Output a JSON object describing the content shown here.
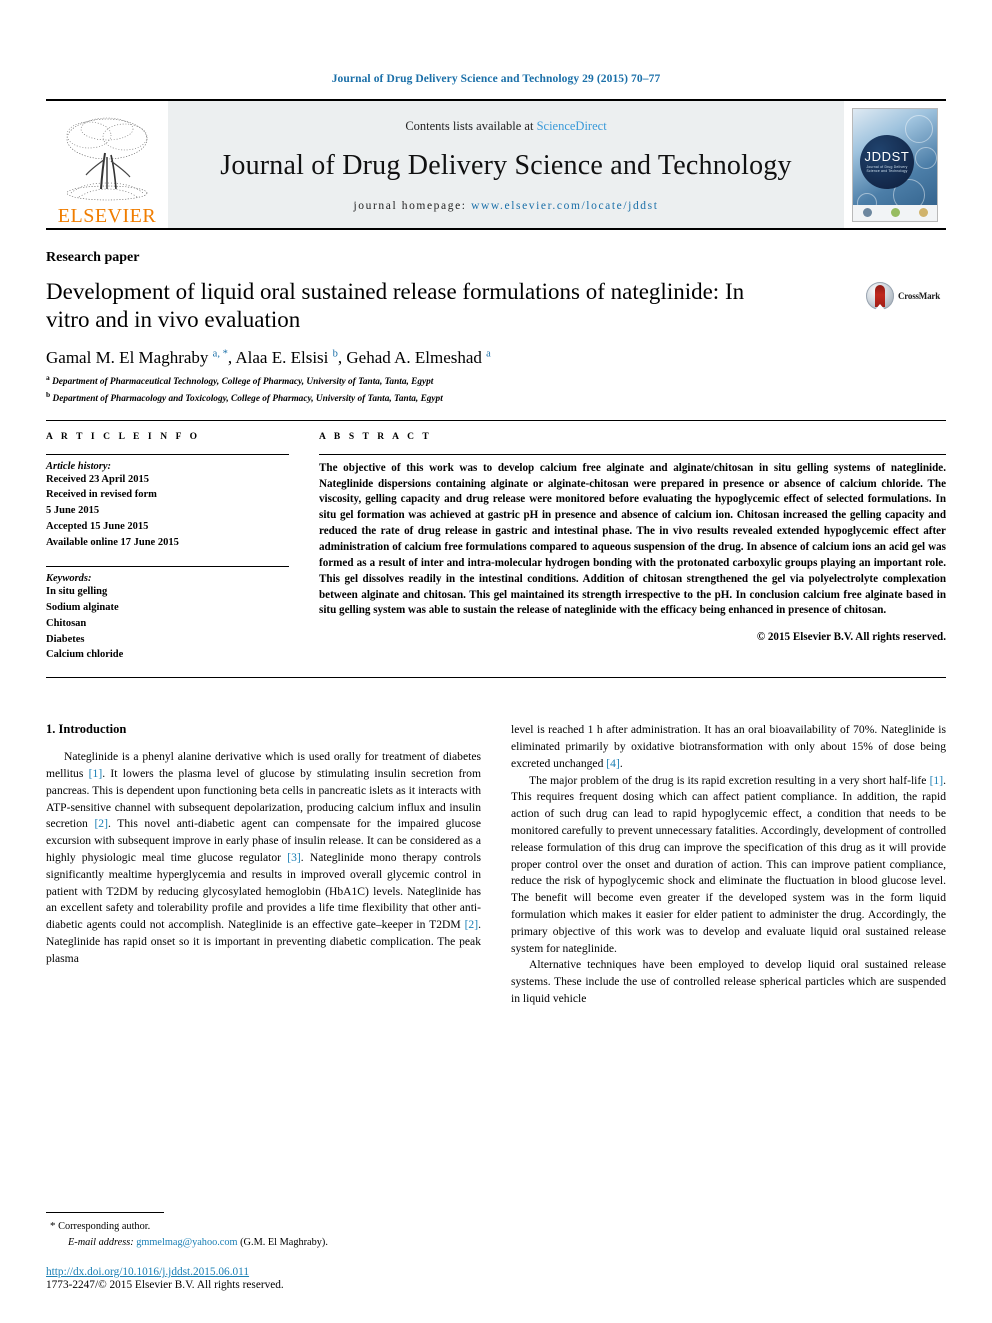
{
  "running_head": "Journal of Drug Delivery Science and Technology 29 (2015) 70–77",
  "masthead": {
    "publisher": "ELSEVIER",
    "contents_prefix": "Contents lists available at ",
    "sciencedirect": "ScienceDirect",
    "journal_title": "Journal of Drug Delivery Science and Technology",
    "homepage_prefix": "journal homepage: ",
    "homepage_url": "www.elsevier.com/locate/jddst",
    "cover_title": "JDDST",
    "cover_subtitle": "Journal of Drug Delivery Science and Technology"
  },
  "article": {
    "type": "Research paper",
    "title": "Development of liquid oral sustained release formulations of nateglinide: In vitro and in vivo evaluation",
    "crossmark_label": "CrossMark",
    "authors_html": "Gamal M. El Maghraby <sup>a, *</sup>, Alaa E. Elsisi <sup>b</sup>, Gehad A. Elmeshad <sup>a</sup>",
    "affiliations": [
      {
        "marker": "a",
        "text": "Department of Pharmaceutical Technology, College of Pharmacy, University of Tanta, Tanta, Egypt"
      },
      {
        "marker": "b",
        "text": "Department of Pharmacology and Toxicology, College of Pharmacy, University of Tanta, Tanta, Egypt"
      }
    ]
  },
  "article_info": {
    "heading": "A R T I C L E  I N F O",
    "history_label": "Article history:",
    "history_lines": [
      "Received 23 April 2015",
      "Received in revised form",
      "5 June 2015",
      "Accepted 15 June 2015",
      "Available online 17 June 2015"
    ],
    "keywords_label": "Keywords:",
    "keywords": [
      "In situ gelling",
      "Sodium alginate",
      "Chitosan",
      "Diabetes",
      "Calcium chloride"
    ]
  },
  "abstract": {
    "heading": "A B S T R A C T",
    "text": "The objective of this work was to develop calcium free alginate and alginate/chitosan in situ gelling systems of nateglinide. Nateglinide dispersions containing alginate or alginate-chitosan were prepared in presence or absence of calcium chloride. The viscosity, gelling capacity and drug release were monitored before evaluating the hypoglycemic effect of selected formulations. In situ gel formation was achieved at gastric pH in presence and absence of calcium ion. Chitosan increased the gelling capacity and reduced the rate of drug release in gastric and intestinal phase. The in vivo results revealed extended hypoglycemic effect after administration of calcium free formulations compared to aqueous suspension of the drug. In absence of calcium ions an acid gel was formed as a result of inter and intra-molecular hydrogen bonding with the protonated carboxylic groups playing an important role. This gel dissolves readily in the intestinal conditions. Addition of chitosan strengthened the gel via polyelectrolyte complexation between alginate and chitosan. This gel maintained its strength irrespective to the pH. In conclusion calcium free alginate based in situ gelling system was able to sustain the release of nateglinide with the efficacy being enhanced in presence of chitosan.",
    "copyright": "© 2015 Elsevier B.V. All rights reserved."
  },
  "body": {
    "section_heading": "1. Introduction",
    "left_paragraph_1_html": "Nateglinide is a phenyl alanine derivative which is used orally for treatment of diabetes mellitus <span class=\"ref\">[1]</span>. It lowers the plasma level of glucose by stimulating insulin secretion from pancreas. This is dependent upon functioning beta cells in pancreatic islets as it interacts with ATP-sensitive channel with subsequent depolarization, producing calcium influx and insulin secretion <span class=\"ref\">[2]</span>. This novel anti-diabetic agent can compensate for the impaired glucose excursion with subsequent improve in early phase of insulin release. It can be considered as a highly physiologic meal time glucose regulator <span class=\"ref\">[3]</span>. Nateglinide mono therapy controls significantly mealtime hyperglycemia and results in improved overall glycemic control in patient with T2DM by reducing glycosylated hemoglobin (HbA1C) levels. Nateglinide has an excellent safety and tolerability profile and provides a life time flexibility that other anti-diabetic agents could not accomplish. Nateglinide is an effective gate–keeper in T2DM <span class=\"ref\">[2]</span>. Nateglinide has rapid onset so it is important in preventing diabetic complication. The peak plasma",
    "right_paragraph_1_html": "level is reached 1 h after administration. It has an oral bioavailability of 70%. Nateglinide is eliminated primarily by oxidative biotransformation with only about 15% of dose being excreted unchanged <span class=\"ref\">[4]</span>.",
    "right_paragraph_2_html": "The major problem of the drug is its rapid excretion resulting in a very short half-life <span class=\"ref\">[1]</span>. This requires frequent dosing which can affect patient compliance. In addition, the rapid action of such drug can lead to rapid hypoglycemic effect, a condition that needs to be monitored carefully to prevent unnecessary fatalities. Accordingly, development of controlled release formulation of this drug can improve the specification of this drug as it will provide proper control over the onset and duration of action. This can improve patient compliance, reduce the risk of hypoglycemic shock and eliminate the fluctuation in blood glucose level. The benefit will become even greater if the developed system was in the form liquid formulation which makes it easier for elder patient to administer the drug. Accordingly, the primary objective of this work was to develop and evaluate liquid oral sustained release system for nateglinide.",
    "right_paragraph_3_html": "Alternative techniques have been employed to develop liquid oral sustained release systems. These include the use of controlled release spherical particles which are suspended in liquid vehicle"
  },
  "footnote": {
    "star": "*",
    "corresponding": "Corresponding author.",
    "email_label": "E-mail address:",
    "email": "gmmelmag@yahoo.com",
    "email_owner": "(G.M. El Maghraby)."
  },
  "footer": {
    "doi": "http://dx.doi.org/10.1016/j.jddst.2015.06.011",
    "issn_line": "1773-2247/© 2015 Elsevier B.V. All rights reserved."
  },
  "colors": {
    "link": "#1a7fb5",
    "running_head": "#1a6fa8",
    "elsevier_orange": "#f07d00",
    "sciencedirect": "#3a9ad9"
  }
}
